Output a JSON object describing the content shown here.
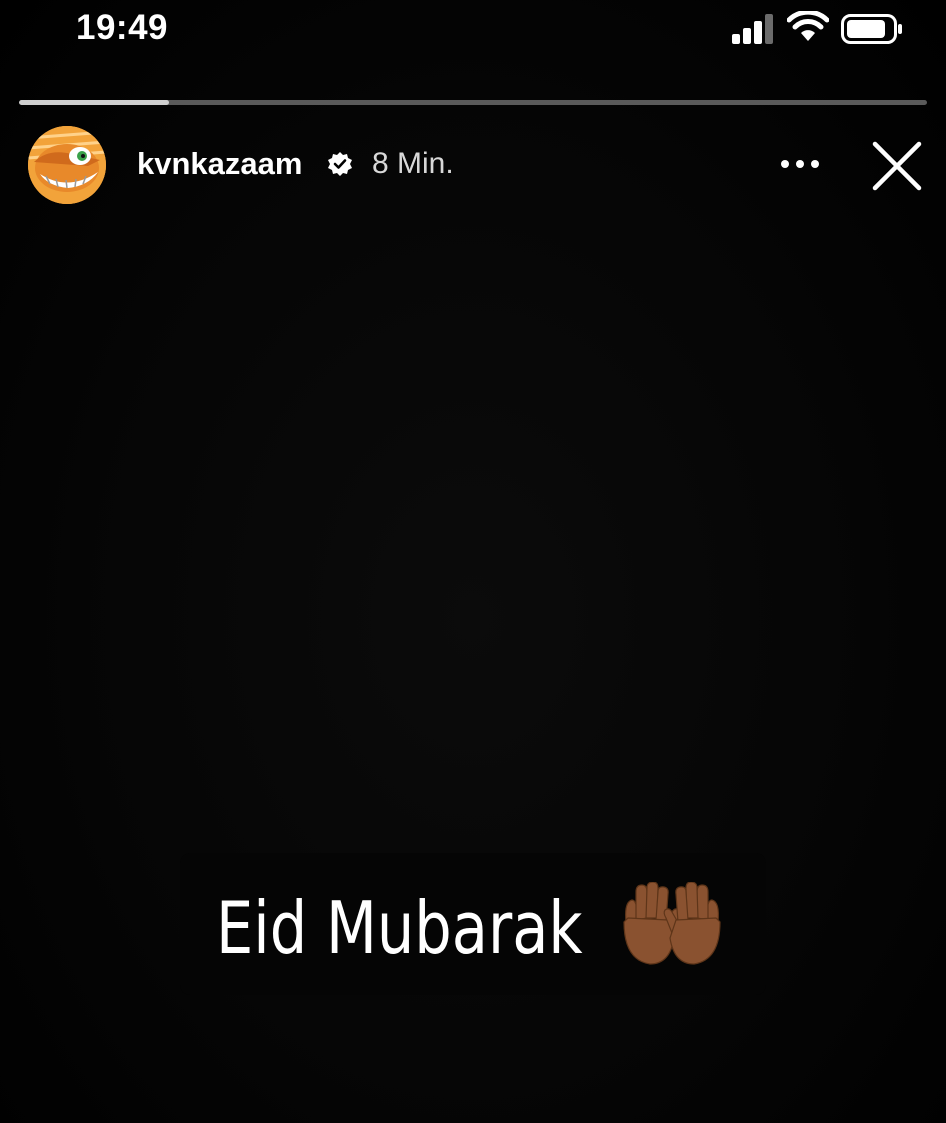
{
  "status_bar": {
    "time": "19:49",
    "icons": [
      "signal-icon",
      "wifi-icon",
      "battery-icon"
    ]
  },
  "story": {
    "progress": 0.165,
    "user": {
      "username": "kvnkazaam",
      "verified": true,
      "avatar": "cartoon-avatar"
    },
    "posted_ago": "8 Min.",
    "caption": "Eid Mubarak",
    "caption_emoji": "palms-up-together-medium-dark-skin"
  },
  "colors": {
    "background": "#000000",
    "text": "#ffffff",
    "progress_track": "#5a5a5a",
    "progress_fill": "#cfcfcf",
    "avatar_orange": "#f2a33a",
    "emoji_skin": "#8a5230"
  }
}
